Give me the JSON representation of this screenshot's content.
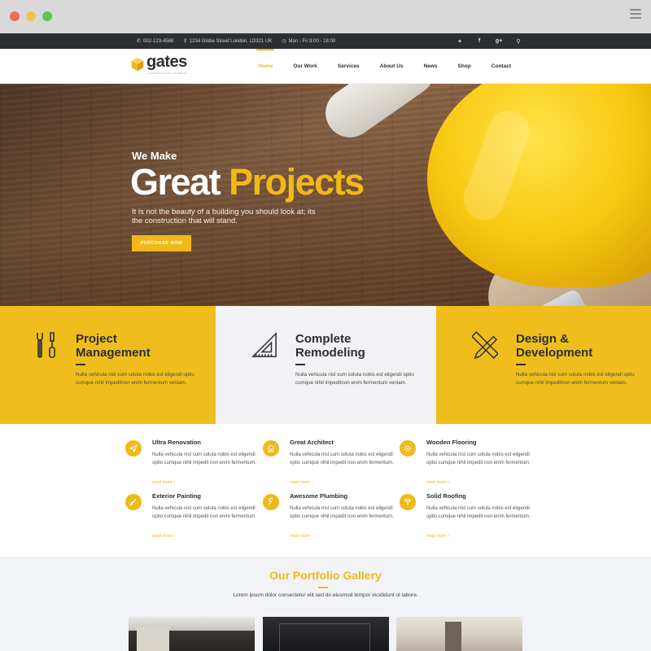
{
  "topbar": {
    "phone": "002-123-4568",
    "address": "1234 Globe Street London, LD321 UK",
    "hours": "Mon - Fri 9:00 - 18:00",
    "social": [
      "twitter-icon",
      "facebook-icon",
      "google-plus-icon",
      "search-icon"
    ]
  },
  "brand": {
    "name": "gates",
    "tagline": "CONSTRUCTION COMPANY",
    "accent": "#f0b91a",
    "dark": "#2b2e33"
  },
  "menu": [
    "Home",
    "Our Work",
    "Services",
    "About Us",
    "News",
    "Shop",
    "Contact"
  ],
  "hero": {
    "pre": "We Make",
    "title_a": "Great",
    "title_b": "Projects",
    "desc": "It is not the beauty of a building you should look at; its the construction that will stand.",
    "button": "PURCHASE NOW"
  },
  "features": [
    {
      "title_1": "Project",
      "title_2": "Management",
      "text": "Nulla vehicula nisl cum soluta nobis est eligendi optio cumque nihil impeditnon enim fermentum veniam.",
      "icon": "tools-icon"
    },
    {
      "title_1": "Complete",
      "title_2": "Remodeling",
      "text": "Nulla vehicula nisl cum soluta nobis est eligendi optio cumque nihil impeditnon enim fermentum veniam.",
      "icon": "set-square-icon"
    },
    {
      "title_1": "Design &",
      "title_2": "Development",
      "text": "Nulla vehicula nisl cum soluta nobis est eligendi optio cumque nihil impeditnon enim fermentum veniam.",
      "icon": "ruler-pencil-icon"
    }
  ],
  "services": [
    {
      "title": "Ultra Renovation",
      "text": "Nulla vehicula nisl cum soluta nobis est eligendi optio cumque nihil impedit non enim fermentum.",
      "link": "read more ›",
      "icon": "paper-plane-icon"
    },
    {
      "title": "Great Architect",
      "text": "Nulla vehicula nisl cum soluta nobis est eligendi optio cumque nihil impedit non enim fermentum.",
      "link": "read more ›",
      "icon": "building-icon"
    },
    {
      "title": "Wooden Flooring",
      "text": "Nulla vehicula nisl cum soluta nobis est eligendi optio cumque nihil impedit non enim fermentum.",
      "link": "read more ›",
      "icon": "gear-icon"
    },
    {
      "title": "Exterior Painting",
      "text": "Nulla vehicula nisl cum soluta nobis est eligendi optio cumque nihil impedit non enim fermentum.",
      "link": "read more ›",
      "icon": "paint-brush-icon"
    },
    {
      "title": "Awesome Plumbing",
      "text": "Nulla vehicula nisl cum soluta nobis est eligendi optio cumque nihil impedit non enim fermentum.",
      "link": "read more ›",
      "icon": "wrench-icon"
    },
    {
      "title": "Solid Roofing",
      "text": "Nulla vehicula nisl cum soluta nobis est eligendi optio cumque nihil impedit non enim fermentum.",
      "link": "read more ›",
      "icon": "hammer-icon"
    }
  ],
  "portfolio": {
    "title": "Our Portfolio Gallery",
    "text": "Lorem ipsum dolor consectetur elit sed do eiusmod tempor incididunt ut labore."
  }
}
